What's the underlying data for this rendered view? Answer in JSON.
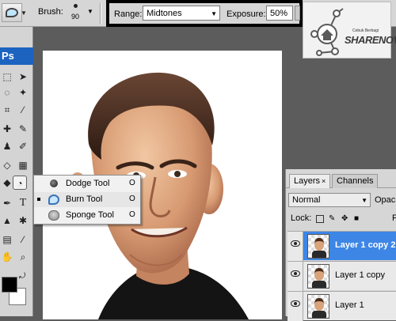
{
  "options_bar": {
    "brush_label": "Brush:",
    "brush_size": "90",
    "range_label": "Range:",
    "range_value": "Midtones",
    "exposure_label": "Exposure:",
    "exposure_value": "50%"
  },
  "logo": {
    "text": "SHARENOVEL",
    "tagline": "Cebuk Berbagi",
    "icon": "house-network-icon"
  },
  "toolbox": {
    "badge": "Ps",
    "type_tool_glyph": "T"
  },
  "tool_flyout": {
    "items": [
      {
        "label": "Dodge Tool",
        "shortcut": "O",
        "icon": "dodge-icon",
        "active": false
      },
      {
        "label": "Burn Tool",
        "shortcut": "O",
        "icon": "burn-icon",
        "active": true
      },
      {
        "label": "Sponge Tool",
        "shortcut": "O",
        "icon": "sponge-icon",
        "active": false
      }
    ]
  },
  "layers_panel": {
    "tabs": [
      "Layers",
      "Channels"
    ],
    "tab_close": "×",
    "blend_mode": "Normal",
    "opacity_label": "Opaci",
    "lock_label": "Lock:",
    "fill_label": "F",
    "layers": [
      {
        "name": "Layer 1 copy 2",
        "selected": true,
        "visible": true
      },
      {
        "name": "Layer 1 copy",
        "selected": false,
        "visible": true
      },
      {
        "name": "Layer 1",
        "selected": false,
        "visible": true
      }
    ]
  },
  "colors": {
    "accent": "#1b63bf",
    "selected_layer": "#3d86e6",
    "foreground": "#000000",
    "background": "#ffffff"
  }
}
